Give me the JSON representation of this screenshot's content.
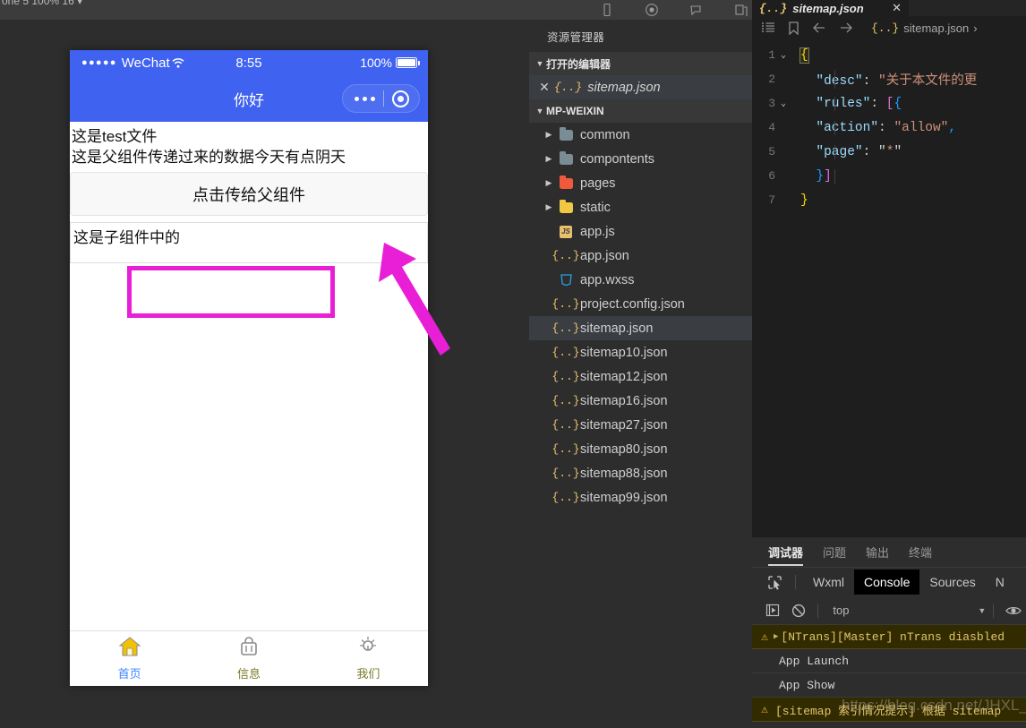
{
  "toolbar": {
    "left_text": "one 5 100% 16 ▾",
    "icons": [
      "device-icon",
      "record-icon",
      "clip-icon",
      "share-icon"
    ]
  },
  "simulator": {
    "status_bar": {
      "signal_dots": "●●●●●",
      "carrier": "WeChat",
      "wifi_icon": "wifi-icon",
      "time": "8:55",
      "battery_percent": "100%",
      "battery_icon": "battery-full-icon"
    },
    "nav": {
      "title": "你好",
      "capsule_more_icon": "more-dots-icon",
      "capsule_close_icon": "target-circle-icon"
    },
    "content": {
      "line1": "这是test文件",
      "line2": "这是父组件传递过来的数据今天有点阴天",
      "button_label": "点击传给父组件",
      "child_box_text": "这是子组件中的",
      "highlight_color": "#e81fd6",
      "arrow_color": "#e81fd6"
    },
    "tabbar": [
      {
        "label": "首页",
        "icon": "home-icon",
        "color": "#3a86ff",
        "icon_color": "#f2c200",
        "active": true
      },
      {
        "label": "信息",
        "icon": "bag-icon",
        "color": "#7a7a2a",
        "icon_color": "#8a8a8a",
        "active": false
      },
      {
        "label": "我们",
        "icon": "idea-icon",
        "color": "#7a7a2a",
        "icon_color": "#8a8a8a",
        "active": false
      }
    ]
  },
  "explorer": {
    "title": "资源管理器",
    "sections": [
      {
        "label": "打开的编辑器",
        "expanded": true
      },
      {
        "label": "MP-WEIXIN",
        "expanded": true
      }
    ],
    "open_editors": [
      {
        "name": "sitemap.json",
        "icon": "json-icon",
        "close_icon": "close-icon",
        "selected": true
      }
    ],
    "tree": [
      {
        "name": "common",
        "type": "folder",
        "icon": "folder-icon",
        "color": "#7a8d95",
        "expandable": true,
        "selected": false
      },
      {
        "name": "compontents",
        "type": "folder",
        "icon": "folder-icon",
        "color": "#7a8d95",
        "expandable": true,
        "selected": false
      },
      {
        "name": "pages",
        "type": "folder",
        "icon": "folder-pages-icon",
        "color": "#f05a3c",
        "expandable": true,
        "selected": false
      },
      {
        "name": "static",
        "type": "folder",
        "icon": "folder-static-icon",
        "color": "#f2c744",
        "expandable": true,
        "selected": false
      },
      {
        "name": "app.js",
        "type": "file",
        "icon": "js-icon",
        "color": "#e8c16c",
        "expandable": false,
        "selected": false
      },
      {
        "name": "app.json",
        "type": "file",
        "icon": "json-icon",
        "color": "#e8c16c",
        "expandable": false,
        "selected": false
      },
      {
        "name": "app.wxss",
        "type": "file",
        "icon": "css-icon",
        "color": "#2b9fe0",
        "expandable": false,
        "selected": false
      },
      {
        "name": "project.config.json",
        "type": "file",
        "icon": "json-icon",
        "color": "#e8c16c",
        "expandable": false,
        "selected": false
      },
      {
        "name": "sitemap.json",
        "type": "file",
        "icon": "json-icon",
        "color": "#e8c16c",
        "expandable": false,
        "selected": true
      },
      {
        "name": "sitemap10.json",
        "type": "file",
        "icon": "json-icon",
        "color": "#e8c16c",
        "expandable": false,
        "selected": false
      },
      {
        "name": "sitemap12.json",
        "type": "file",
        "icon": "json-icon",
        "color": "#e8c16c",
        "expandable": false,
        "selected": false
      },
      {
        "name": "sitemap16.json",
        "type": "file",
        "icon": "json-icon",
        "color": "#e8c16c",
        "expandable": false,
        "selected": false
      },
      {
        "name": "sitemap27.json",
        "type": "file",
        "icon": "json-icon",
        "color": "#e8c16c",
        "expandable": false,
        "selected": false
      },
      {
        "name": "sitemap80.json",
        "type": "file",
        "icon": "json-icon",
        "color": "#e8c16c",
        "expandable": false,
        "selected": false
      },
      {
        "name": "sitemap88.json",
        "type": "file",
        "icon": "json-icon",
        "color": "#e8c16c",
        "expandable": false,
        "selected": false
      },
      {
        "name": "sitemap99.json",
        "type": "file",
        "icon": "json-icon",
        "color": "#e8c16c",
        "expandable": false,
        "selected": false
      }
    ]
  },
  "editor": {
    "tab": {
      "label": "sitemap.json",
      "icon": "json-icon",
      "close_icon": "close-icon",
      "active": true
    },
    "breadcrumb": {
      "outline_icon": "outline-icon",
      "bookmark_icon": "bookmark-icon",
      "back_icon": "arrow-left-icon",
      "forward_icon": "arrow-right-icon",
      "file": "sitemap.json",
      "separator": "›"
    },
    "lines": [
      {
        "no": "1",
        "fold": "v",
        "text": "{"
      },
      {
        "no": "2",
        "fold": "",
        "text": "\"desc\": \"关于本文件的更"
      },
      {
        "no": "3",
        "fold": "v",
        "text": "\"rules\": [{"
      },
      {
        "no": "4",
        "fold": "",
        "text": "\"action\": \"allow\","
      },
      {
        "no": "5",
        "fold": "",
        "text": "\"page\": \"*\""
      },
      {
        "no": "6",
        "fold": "",
        "text": "}]"
      },
      {
        "no": "7",
        "fold": "",
        "text": "}"
      }
    ],
    "colors": {
      "key": "#9cdcfe",
      "string": "#ce9178",
      "brace": "#ffd700",
      "bracket": "#da70d6",
      "punct": "#d4d4d4"
    }
  },
  "console": {
    "panel_tabs": [
      {
        "label": "调试器",
        "active": true
      },
      {
        "label": "问题",
        "active": false
      },
      {
        "label": "输出",
        "active": false
      },
      {
        "label": "终端",
        "active": false
      }
    ],
    "devtool_tabs": [
      {
        "label": "Wxml",
        "active": false
      },
      {
        "label": "Console",
        "active": true
      },
      {
        "label": "Sources",
        "active": false
      },
      {
        "label": "N",
        "active": false
      }
    ],
    "picker_icon": "inspect-picker-icon",
    "toolbar": {
      "execute_icon": "step-icon",
      "clear_icon": "clear-console-icon",
      "context": "top",
      "context_arrow_icon": "chevron-down-icon",
      "eye_icon": "eye-icon"
    },
    "logs": [
      {
        "level": "warn",
        "expandable": true,
        "text": "[NTrans][Master] nTrans diasbled"
      },
      {
        "level": "info",
        "expandable": false,
        "text": "App Launch"
      },
      {
        "level": "info",
        "expandable": false,
        "text": "App Show"
      },
      {
        "level": "warn",
        "expandable": false,
        "text": "[sitemap 索引情况提示] 根据 sitemap"
      }
    ]
  },
  "watermark": "https://blog.csdn.net/JHXL_"
}
